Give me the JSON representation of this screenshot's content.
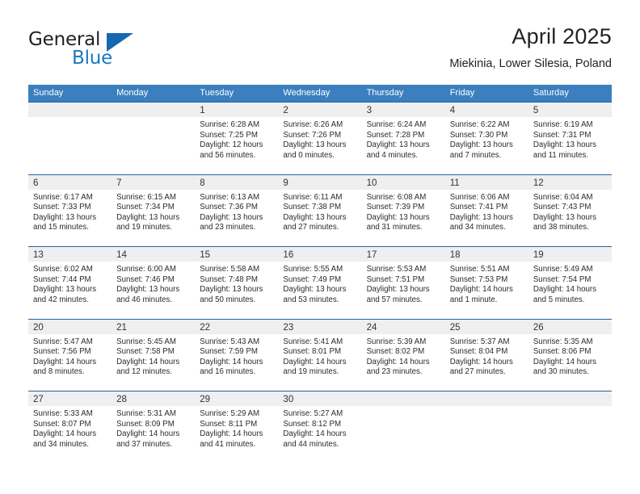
{
  "logo": {
    "text_primary": "General",
    "text_secondary": "Blue",
    "triangle_color": "#1568b0",
    "secondary_color": "#1878be"
  },
  "header": {
    "month_year": "April 2025",
    "location": "Miekinia, Lower Silesia, Poland"
  },
  "colors": {
    "header_band": "#3b7fbf",
    "week_divider": "#1f63a8",
    "date_strip": "#efefef",
    "text": "#222222"
  },
  "weekdays": [
    "Sunday",
    "Monday",
    "Tuesday",
    "Wednesday",
    "Thursday",
    "Friday",
    "Saturday"
  ],
  "labels": {
    "sunrise_prefix": "Sunrise:",
    "sunset_prefix": "Sunset:",
    "daylight_prefix": "Daylight:"
  },
  "weeks": [
    [
      {
        "day": "",
        "sunrise": "",
        "sunset": "",
        "daylight": ""
      },
      {
        "day": "",
        "sunrise": "",
        "sunset": "",
        "daylight": ""
      },
      {
        "day": "1",
        "sunrise": "Sunrise: 6:28 AM",
        "sunset": "Sunset: 7:25 PM",
        "daylight": "Daylight: 12 hours and 56 minutes."
      },
      {
        "day": "2",
        "sunrise": "Sunrise: 6:26 AM",
        "sunset": "Sunset: 7:26 PM",
        "daylight": "Daylight: 13 hours and 0 minutes."
      },
      {
        "day": "3",
        "sunrise": "Sunrise: 6:24 AM",
        "sunset": "Sunset: 7:28 PM",
        "daylight": "Daylight: 13 hours and 4 minutes."
      },
      {
        "day": "4",
        "sunrise": "Sunrise: 6:22 AM",
        "sunset": "Sunset: 7:30 PM",
        "daylight": "Daylight: 13 hours and 7 minutes."
      },
      {
        "day": "5",
        "sunrise": "Sunrise: 6:19 AM",
        "sunset": "Sunset: 7:31 PM",
        "daylight": "Daylight: 13 hours and 11 minutes."
      }
    ],
    [
      {
        "day": "6",
        "sunrise": "Sunrise: 6:17 AM",
        "sunset": "Sunset: 7:33 PM",
        "daylight": "Daylight: 13 hours and 15 minutes."
      },
      {
        "day": "7",
        "sunrise": "Sunrise: 6:15 AM",
        "sunset": "Sunset: 7:34 PM",
        "daylight": "Daylight: 13 hours and 19 minutes."
      },
      {
        "day": "8",
        "sunrise": "Sunrise: 6:13 AM",
        "sunset": "Sunset: 7:36 PM",
        "daylight": "Daylight: 13 hours and 23 minutes."
      },
      {
        "day": "9",
        "sunrise": "Sunrise: 6:11 AM",
        "sunset": "Sunset: 7:38 PM",
        "daylight": "Daylight: 13 hours and 27 minutes."
      },
      {
        "day": "10",
        "sunrise": "Sunrise: 6:08 AM",
        "sunset": "Sunset: 7:39 PM",
        "daylight": "Daylight: 13 hours and 31 minutes."
      },
      {
        "day": "11",
        "sunrise": "Sunrise: 6:06 AM",
        "sunset": "Sunset: 7:41 PM",
        "daylight": "Daylight: 13 hours and 34 minutes."
      },
      {
        "day": "12",
        "sunrise": "Sunrise: 6:04 AM",
        "sunset": "Sunset: 7:43 PM",
        "daylight": "Daylight: 13 hours and 38 minutes."
      }
    ],
    [
      {
        "day": "13",
        "sunrise": "Sunrise: 6:02 AM",
        "sunset": "Sunset: 7:44 PM",
        "daylight": "Daylight: 13 hours and 42 minutes."
      },
      {
        "day": "14",
        "sunrise": "Sunrise: 6:00 AM",
        "sunset": "Sunset: 7:46 PM",
        "daylight": "Daylight: 13 hours and 46 minutes."
      },
      {
        "day": "15",
        "sunrise": "Sunrise: 5:58 AM",
        "sunset": "Sunset: 7:48 PM",
        "daylight": "Daylight: 13 hours and 50 minutes."
      },
      {
        "day": "16",
        "sunrise": "Sunrise: 5:55 AM",
        "sunset": "Sunset: 7:49 PM",
        "daylight": "Daylight: 13 hours and 53 minutes."
      },
      {
        "day": "17",
        "sunrise": "Sunrise: 5:53 AM",
        "sunset": "Sunset: 7:51 PM",
        "daylight": "Daylight: 13 hours and 57 minutes."
      },
      {
        "day": "18",
        "sunrise": "Sunrise: 5:51 AM",
        "sunset": "Sunset: 7:53 PM",
        "daylight": "Daylight: 14 hours and 1 minute."
      },
      {
        "day": "19",
        "sunrise": "Sunrise: 5:49 AM",
        "sunset": "Sunset: 7:54 PM",
        "daylight": "Daylight: 14 hours and 5 minutes."
      }
    ],
    [
      {
        "day": "20",
        "sunrise": "Sunrise: 5:47 AM",
        "sunset": "Sunset: 7:56 PM",
        "daylight": "Daylight: 14 hours and 8 minutes."
      },
      {
        "day": "21",
        "sunrise": "Sunrise: 5:45 AM",
        "sunset": "Sunset: 7:58 PM",
        "daylight": "Daylight: 14 hours and 12 minutes."
      },
      {
        "day": "22",
        "sunrise": "Sunrise: 5:43 AM",
        "sunset": "Sunset: 7:59 PM",
        "daylight": "Daylight: 14 hours and 16 minutes."
      },
      {
        "day": "23",
        "sunrise": "Sunrise: 5:41 AM",
        "sunset": "Sunset: 8:01 PM",
        "daylight": "Daylight: 14 hours and 19 minutes."
      },
      {
        "day": "24",
        "sunrise": "Sunrise: 5:39 AM",
        "sunset": "Sunset: 8:02 PM",
        "daylight": "Daylight: 14 hours and 23 minutes."
      },
      {
        "day": "25",
        "sunrise": "Sunrise: 5:37 AM",
        "sunset": "Sunset: 8:04 PM",
        "daylight": "Daylight: 14 hours and 27 minutes."
      },
      {
        "day": "26",
        "sunrise": "Sunrise: 5:35 AM",
        "sunset": "Sunset: 8:06 PM",
        "daylight": "Daylight: 14 hours and 30 minutes."
      }
    ],
    [
      {
        "day": "27",
        "sunrise": "Sunrise: 5:33 AM",
        "sunset": "Sunset: 8:07 PM",
        "daylight": "Daylight: 14 hours and 34 minutes."
      },
      {
        "day": "28",
        "sunrise": "Sunrise: 5:31 AM",
        "sunset": "Sunset: 8:09 PM",
        "daylight": "Daylight: 14 hours and 37 minutes."
      },
      {
        "day": "29",
        "sunrise": "Sunrise: 5:29 AM",
        "sunset": "Sunset: 8:11 PM",
        "daylight": "Daylight: 14 hours and 41 minutes."
      },
      {
        "day": "30",
        "sunrise": "Sunrise: 5:27 AM",
        "sunset": "Sunset: 8:12 PM",
        "daylight": "Daylight: 14 hours and 44 minutes."
      },
      {
        "day": "",
        "sunrise": "",
        "sunset": "",
        "daylight": ""
      },
      {
        "day": "",
        "sunrise": "",
        "sunset": "",
        "daylight": ""
      },
      {
        "day": "",
        "sunrise": "",
        "sunset": "",
        "daylight": ""
      }
    ]
  ]
}
